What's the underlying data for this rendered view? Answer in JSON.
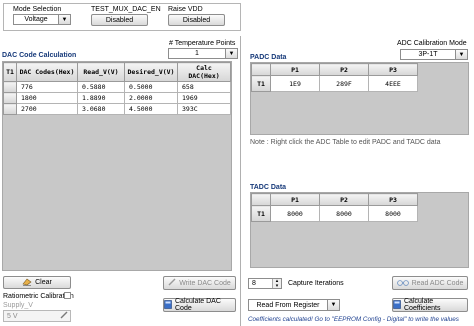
{
  "top_controls": {
    "mode_label": "Mode Selection",
    "mode_value": "Voltage",
    "test_mux_label": "TEST_MUX_DAC_EN",
    "test_mux_button": "Disabled",
    "raise_vdd_label": "Raise VDD",
    "raise_vdd_button": "Disabled"
  },
  "dac": {
    "title": "DAC Code Calculation",
    "temp_points_label": "# Temperature Points",
    "temp_points_value": "1",
    "columns": [
      "T1",
      "DAC Codes(Hex)",
      "Read_V(V)",
      "Desired_V(V)",
      "Calc DAC(Hex)"
    ],
    "rows": [
      [
        "776",
        "0.5880",
        "0.5000",
        "658"
      ],
      [
        "1800",
        "1.8890",
        "2.0000",
        "1969"
      ],
      [
        "2700",
        "3.0680",
        "4.5000",
        "393C"
      ]
    ]
  },
  "adc_mode": {
    "label": "ADC Calibration Mode",
    "value": "3P-1T"
  },
  "padc": {
    "title": "PADC Data",
    "columns": [
      "P1",
      "P2",
      "P3"
    ],
    "row_label": "T1",
    "values": [
      "1E9",
      "289F",
      "4EEE"
    ],
    "note": "Note : Right click the ADC Table to edit PADC and TADC data"
  },
  "tadc": {
    "title": "TADC Data",
    "columns": [
      "P1",
      "P2",
      "P3"
    ],
    "row_label": "T1",
    "values": [
      "8000",
      "8000",
      "8000"
    ]
  },
  "bottom": {
    "clear_label": "Clear",
    "ratiometric_label": "Ratiometric Calibration",
    "supply_label": "Supply_V",
    "supply_value": "5 V",
    "write_dac_label": "Write DAC Code",
    "calculate_dac_label": "Calculate DAC Code",
    "capture_value": "8",
    "capture_label": "Capture Iterations",
    "read_adc_label": "Read ADC Code",
    "read_from_label": "Read From Register",
    "calc_coeff_label": "Calculate Coefficients",
    "status": "Coefficients calculated! Go to \"EEPROM Config - Digital\" to write the values"
  },
  "colors": {
    "title_blue": "#173a7a",
    "grid_gray": "#c8c8c8",
    "status_blue": "#1d3f8f"
  }
}
